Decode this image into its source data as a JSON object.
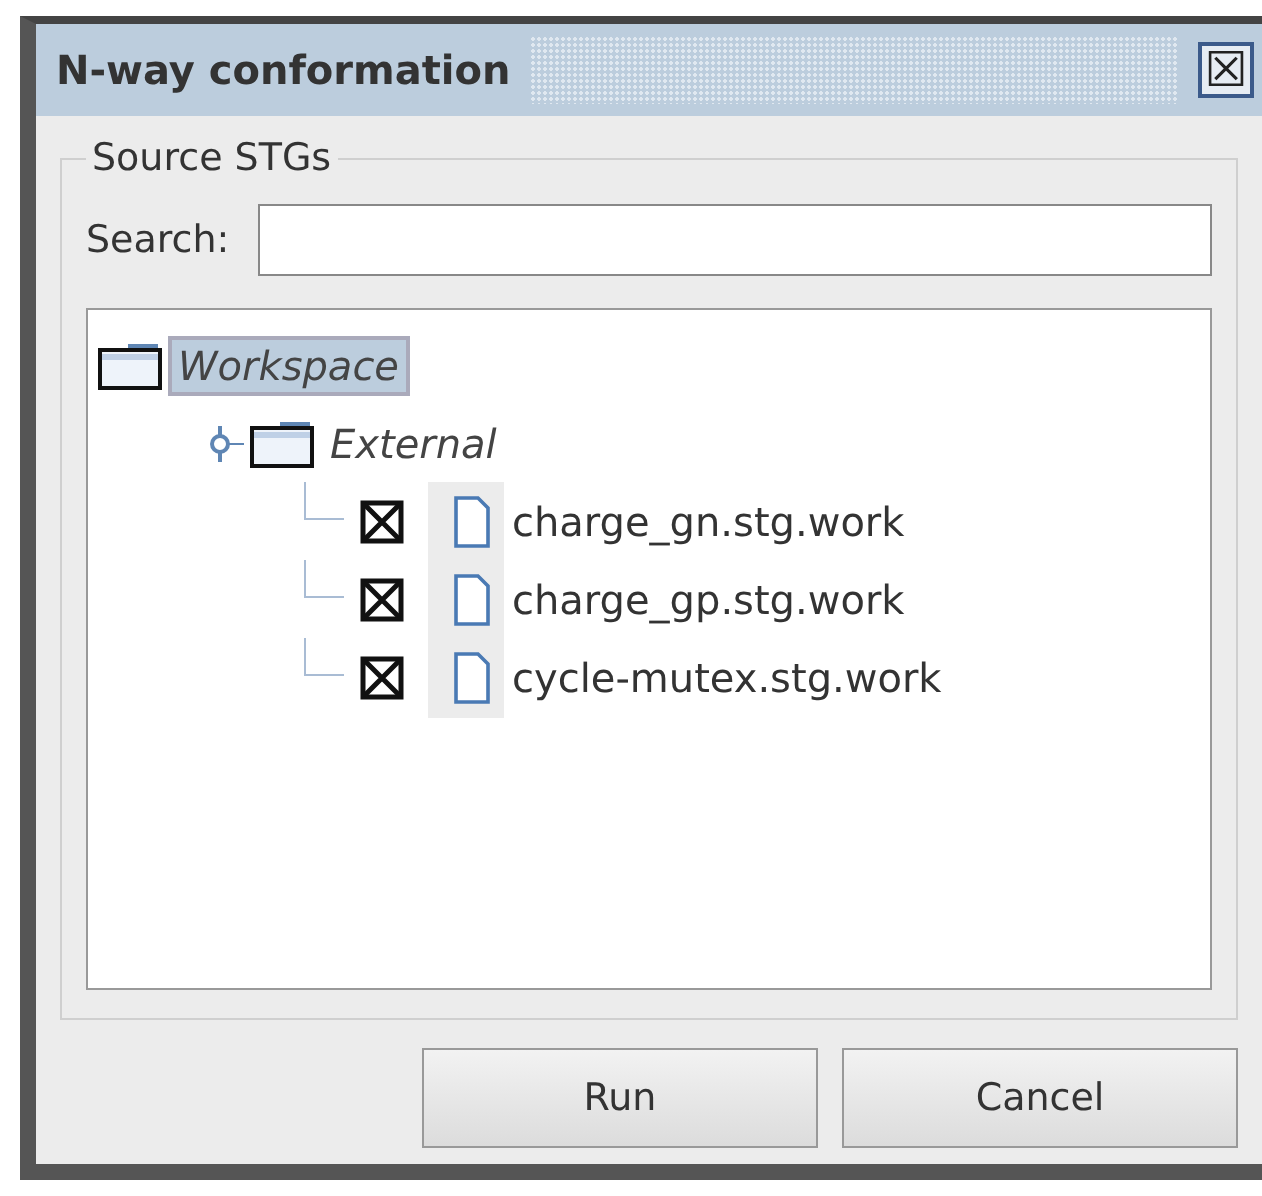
{
  "window": {
    "title": "N-way conformation",
    "close": "☒"
  },
  "source_stgs": {
    "legend": "Source STGs",
    "search": {
      "label": "Search:"
    },
    "tree": [
      {
        "label": "Workspace",
        "kind": "folder",
        "selected": true,
        "children": [
          {
            "label": "External",
            "kind": "folder",
            "selected": false,
            "expanded": true,
            "children": [
              {
                "label": "charge_gn.stg.work",
                "kind": "file",
                "selected": false,
                "checked": true
              },
              {
                "label": "charge_gp.stg.work",
                "kind": "file",
                "selected": false,
                "checked": true
              },
              {
                "label": "cycle-mutex.stg.work",
                "kind": "file",
                "selected": false,
                "checked": true
              }
            ]
          }
        ]
      }
    ]
  },
  "buttons": [
    "Run",
    "Cancel"
  ]
}
